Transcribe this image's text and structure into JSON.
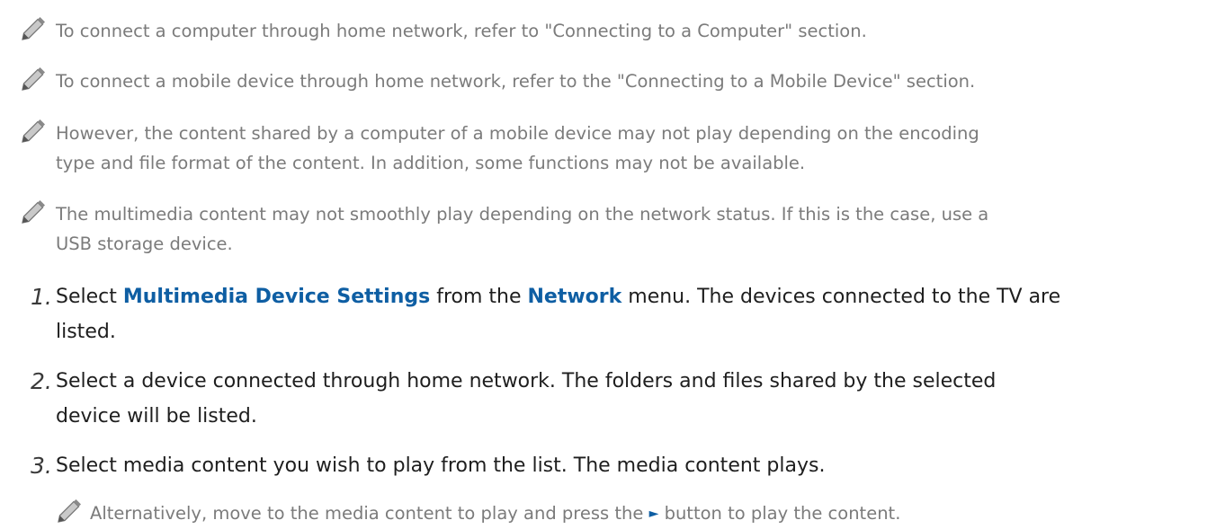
{
  "notes": [
    {
      "lines": [
        "To connect a computer through home network, refer to \"Connecting to a Computer\" section."
      ]
    },
    {
      "lines": [
        "To connect a mobile device through home network, refer to the \"Connecting to a Mobile Device\" section."
      ]
    },
    {
      "lines": [
        "However, the content shared by a computer of a mobile device may not play depending on the encoding",
        "type and file format of the content. In addition, some functions may not be available."
      ]
    },
    {
      "lines": [
        "The multimedia content may not smoothly play depending on the network status. If this is the case, use a",
        "USB storage device."
      ]
    }
  ],
  "steps": [
    {
      "number": "1.",
      "line1_a": "Select ",
      "kw1": "Multimedia Device Settings",
      "line1_b": " from the ",
      "kw2": "Network",
      "line1_c": " menu. The devices connected to the TV are",
      "line2": "listed."
    },
    {
      "number": "2.",
      "line1": "Select a device connected through home network. The folders and files shared by the selected",
      "line2": "device will be listed."
    },
    {
      "number": "3.",
      "line1": "Select media content you wish to play from the list. The media content plays."
    }
  ],
  "subnote": {
    "text_a": "Alternatively, move to the media content to play and press the ",
    "play_symbol": "►",
    "text_b": " button to play the content."
  },
  "icons": {
    "note": "pencil-icon"
  }
}
